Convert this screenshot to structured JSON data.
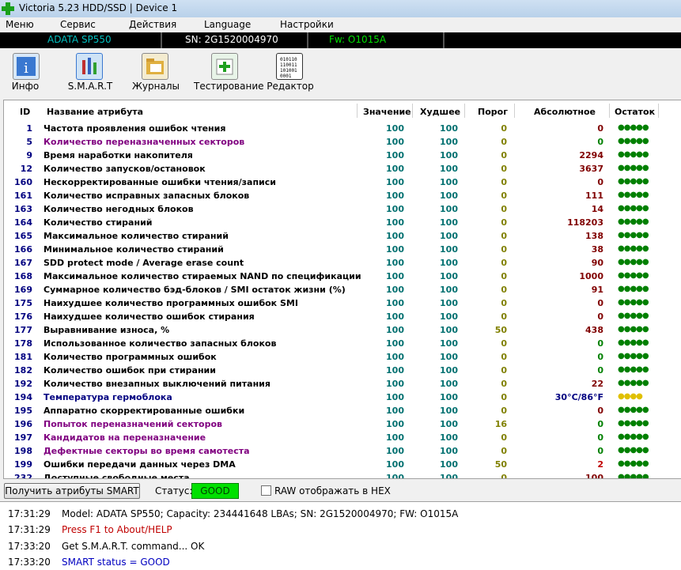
{
  "window": {
    "title": "Victoria 5.23 HDD/SSD | Device 1"
  },
  "menu": [
    "Меню",
    "Сервис",
    "Действия",
    "Language",
    "Настройки"
  ],
  "device": {
    "model": "ADATA SP550",
    "serial": "SN: 2G1520004970",
    "firmware": "Fw: O1015A"
  },
  "toolbar": [
    {
      "label": "Инфо",
      "icon": "info-icon"
    },
    {
      "label": "S.M.A.R.T",
      "icon": "smart-icon"
    },
    {
      "label": "Журналы",
      "icon": "logs-icon"
    },
    {
      "label": "Тестирование",
      "icon": "test-icon"
    },
    {
      "label": "Редактор",
      "icon": "editor-icon"
    }
  ],
  "table": {
    "headers": {
      "id": "ID",
      "name": "Название атрибута",
      "value": "Значение",
      "worst": "Худшее",
      "threshold": "Порог",
      "absolute": "Абсолютное",
      "remaining": "Остаток"
    },
    "rows": [
      {
        "id": "1",
        "name": "Частота проявления ошибок чтения",
        "value": "100",
        "worst": "100",
        "threshold": "0",
        "absolute": "0",
        "remaining": "●●●●●",
        "nameColor": "#000000",
        "absColor": "#800000",
        "remColor": "#008000"
      },
      {
        "id": "5",
        "name": "Количество переназначенных секторов",
        "value": "100",
        "worst": "100",
        "threshold": "0",
        "absolute": "0",
        "remaining": "●●●●●",
        "nameColor": "#800080",
        "absColor": "#008000",
        "remColor": "#008000"
      },
      {
        "id": "9",
        "name": "Время наработки накопителя",
        "value": "100",
        "worst": "100",
        "threshold": "0",
        "absolute": "2294",
        "remaining": "●●●●●",
        "nameColor": "#000000",
        "absColor": "#800000",
        "remColor": "#008000"
      },
      {
        "id": "12",
        "name": "Количество запусков/остановок",
        "value": "100",
        "worst": "100",
        "threshold": "0",
        "absolute": "3637",
        "remaining": "●●●●●",
        "nameColor": "#000000",
        "absColor": "#800000",
        "remColor": "#008000"
      },
      {
        "id": "160",
        "name": "Нескорректированные ошибки чтения/записи",
        "value": "100",
        "worst": "100",
        "threshold": "0",
        "absolute": "0",
        "remaining": "●●●●●",
        "nameColor": "#000000",
        "absColor": "#800000",
        "remColor": "#008000"
      },
      {
        "id": "161",
        "name": "Количество исправных запасных блоков",
        "value": "100",
        "worst": "100",
        "threshold": "0",
        "absolute": "111",
        "remaining": "●●●●●",
        "nameColor": "#000000",
        "absColor": "#800000",
        "remColor": "#008000"
      },
      {
        "id": "163",
        "name": "Количество негодных блоков",
        "value": "100",
        "worst": "100",
        "threshold": "0",
        "absolute": "14",
        "remaining": "●●●●●",
        "nameColor": "#000000",
        "absColor": "#800000",
        "remColor": "#008000"
      },
      {
        "id": "164",
        "name": "Количество стираний",
        "value": "100",
        "worst": "100",
        "threshold": "0",
        "absolute": "118203",
        "remaining": "●●●●●",
        "nameColor": "#000000",
        "absColor": "#800000",
        "remColor": "#008000"
      },
      {
        "id": "165",
        "name": "Максимальное количество стираний",
        "value": "100",
        "worst": "100",
        "threshold": "0",
        "absolute": "138",
        "remaining": "●●●●●",
        "nameColor": "#000000",
        "absColor": "#800000",
        "remColor": "#008000"
      },
      {
        "id": "166",
        "name": "Минимальное количество стираний",
        "value": "100",
        "worst": "100",
        "threshold": "0",
        "absolute": "38",
        "remaining": "●●●●●",
        "nameColor": "#000000",
        "absColor": "#800000",
        "remColor": "#008000"
      },
      {
        "id": "167",
        "name": "SDD protect mode / Average erase count",
        "value": "100",
        "worst": "100",
        "threshold": "0",
        "absolute": "90",
        "remaining": "●●●●●",
        "nameColor": "#000000",
        "absColor": "#800000",
        "remColor": "#008000"
      },
      {
        "id": "168",
        "name": "Максимальное количество стираемых NAND по спецификации",
        "value": "100",
        "worst": "100",
        "threshold": "0",
        "absolute": "1000",
        "remaining": "●●●●●",
        "nameColor": "#000000",
        "absColor": "#800000",
        "remColor": "#008000"
      },
      {
        "id": "169",
        "name": "Суммарное количество бэд-блоков / SMI остаток жизни (%)",
        "value": "100",
        "worst": "100",
        "threshold": "0",
        "absolute": "91",
        "remaining": "●●●●●",
        "nameColor": "#000000",
        "absColor": "#800000",
        "remColor": "#008000"
      },
      {
        "id": "175",
        "name": "Наихудшее количество программных ошибок SMI",
        "value": "100",
        "worst": "100",
        "threshold": "0",
        "absolute": "0",
        "remaining": "●●●●●",
        "nameColor": "#000000",
        "absColor": "#800000",
        "remColor": "#008000"
      },
      {
        "id": "176",
        "name": "Наихудшее количество ошибок стирания",
        "value": "100",
        "worst": "100",
        "threshold": "0",
        "absolute": "0",
        "remaining": "●●●●●",
        "nameColor": "#000000",
        "absColor": "#800000",
        "remColor": "#008000"
      },
      {
        "id": "177",
        "name": "Выравнивание износа, %",
        "value": "100",
        "worst": "100",
        "threshold": "50",
        "absolute": "438",
        "remaining": "●●●●●",
        "nameColor": "#000000",
        "absColor": "#800000",
        "remColor": "#008000"
      },
      {
        "id": "178",
        "name": "Использованное количество запасных блоков",
        "value": "100",
        "worst": "100",
        "threshold": "0",
        "absolute": "0",
        "remaining": "●●●●●",
        "nameColor": "#000000",
        "absColor": "#008000",
        "remColor": "#008000"
      },
      {
        "id": "181",
        "name": "Количество программных ошибок",
        "value": "100",
        "worst": "100",
        "threshold": "0",
        "absolute": "0",
        "remaining": "●●●●●",
        "nameColor": "#000000",
        "absColor": "#008000",
        "remColor": "#008000"
      },
      {
        "id": "182",
        "name": "Количество ошибок при стирании",
        "value": "100",
        "worst": "100",
        "threshold": "0",
        "absolute": "0",
        "remaining": "●●●●●",
        "nameColor": "#000000",
        "absColor": "#008000",
        "remColor": "#008000"
      },
      {
        "id": "192",
        "name": "Количество внезапных выключений питания",
        "value": "100",
        "worst": "100",
        "threshold": "0",
        "absolute": "22",
        "remaining": "●●●●●",
        "nameColor": "#000000",
        "absColor": "#800000",
        "remColor": "#008000"
      },
      {
        "id": "194",
        "name": "Температура гермоблока",
        "value": "100",
        "worst": "100",
        "threshold": "0",
        "absolute": "30°C/86°F",
        "remaining": "●●●●",
        "nameColor": "#000080",
        "absColor": "#000080",
        "remColor": "#e0c000"
      },
      {
        "id": "195",
        "name": "Аппаратно скорректированные ошибки",
        "value": "100",
        "worst": "100",
        "threshold": "0",
        "absolute": "0",
        "remaining": "●●●●●",
        "nameColor": "#000000",
        "absColor": "#800000",
        "remColor": "#008000"
      },
      {
        "id": "196",
        "name": "Попыток переназначений секторов",
        "value": "100",
        "worst": "100",
        "threshold": "16",
        "absolute": "0",
        "remaining": "●●●●●",
        "nameColor": "#800080",
        "absColor": "#008000",
        "remColor": "#008000"
      },
      {
        "id": "197",
        "name": "Кандидатов на переназначение",
        "value": "100",
        "worst": "100",
        "threshold": "0",
        "absolute": "0",
        "remaining": "●●●●●",
        "nameColor": "#800080",
        "absColor": "#008000",
        "remColor": "#008000"
      },
      {
        "id": "198",
        "name": "Дефектные секторы во время самотеста",
        "value": "100",
        "worst": "100",
        "threshold": "0",
        "absolute": "0",
        "remaining": "●●●●●",
        "nameColor": "#800080",
        "absColor": "#008000",
        "remColor": "#008000"
      },
      {
        "id": "199",
        "name": "Ошибки передачи данных через DMA",
        "value": "100",
        "worst": "100",
        "threshold": "50",
        "absolute": "2",
        "remaining": "●●●●●",
        "nameColor": "#000000",
        "absColor": "#c00000",
        "remColor": "#008000"
      },
      {
        "id": "232",
        "name": "Доступные свободные места",
        "value": "100",
        "worst": "100",
        "threshold": "0",
        "absolute": "100",
        "remaining": "●●●●●",
        "nameColor": "#000000",
        "absColor": "#800000",
        "remColor": "#008000"
      }
    ]
  },
  "status": {
    "button_label": "Получить атрибуты SMART",
    "label": "Статус:",
    "value": "GOOD",
    "raw_hex_label": "RAW отображать в HEX"
  },
  "log": [
    {
      "time": "17:31:29",
      "text": "Model: ADATA SP550; Capacity: 234441648 LBAs; SN: 2G1520004970; FW: O1015A",
      "color": "#000000"
    },
    {
      "time": "17:31:29",
      "text": "Press F1 to About/HELP",
      "color": "#c00000"
    },
    {
      "time": "17:33:20",
      "text": "Get S.M.A.R.T. command... OK",
      "color": "#000000"
    },
    {
      "time": "17:33:20",
      "text": "SMART status = GOOD",
      "color": "#0000c0"
    }
  ]
}
